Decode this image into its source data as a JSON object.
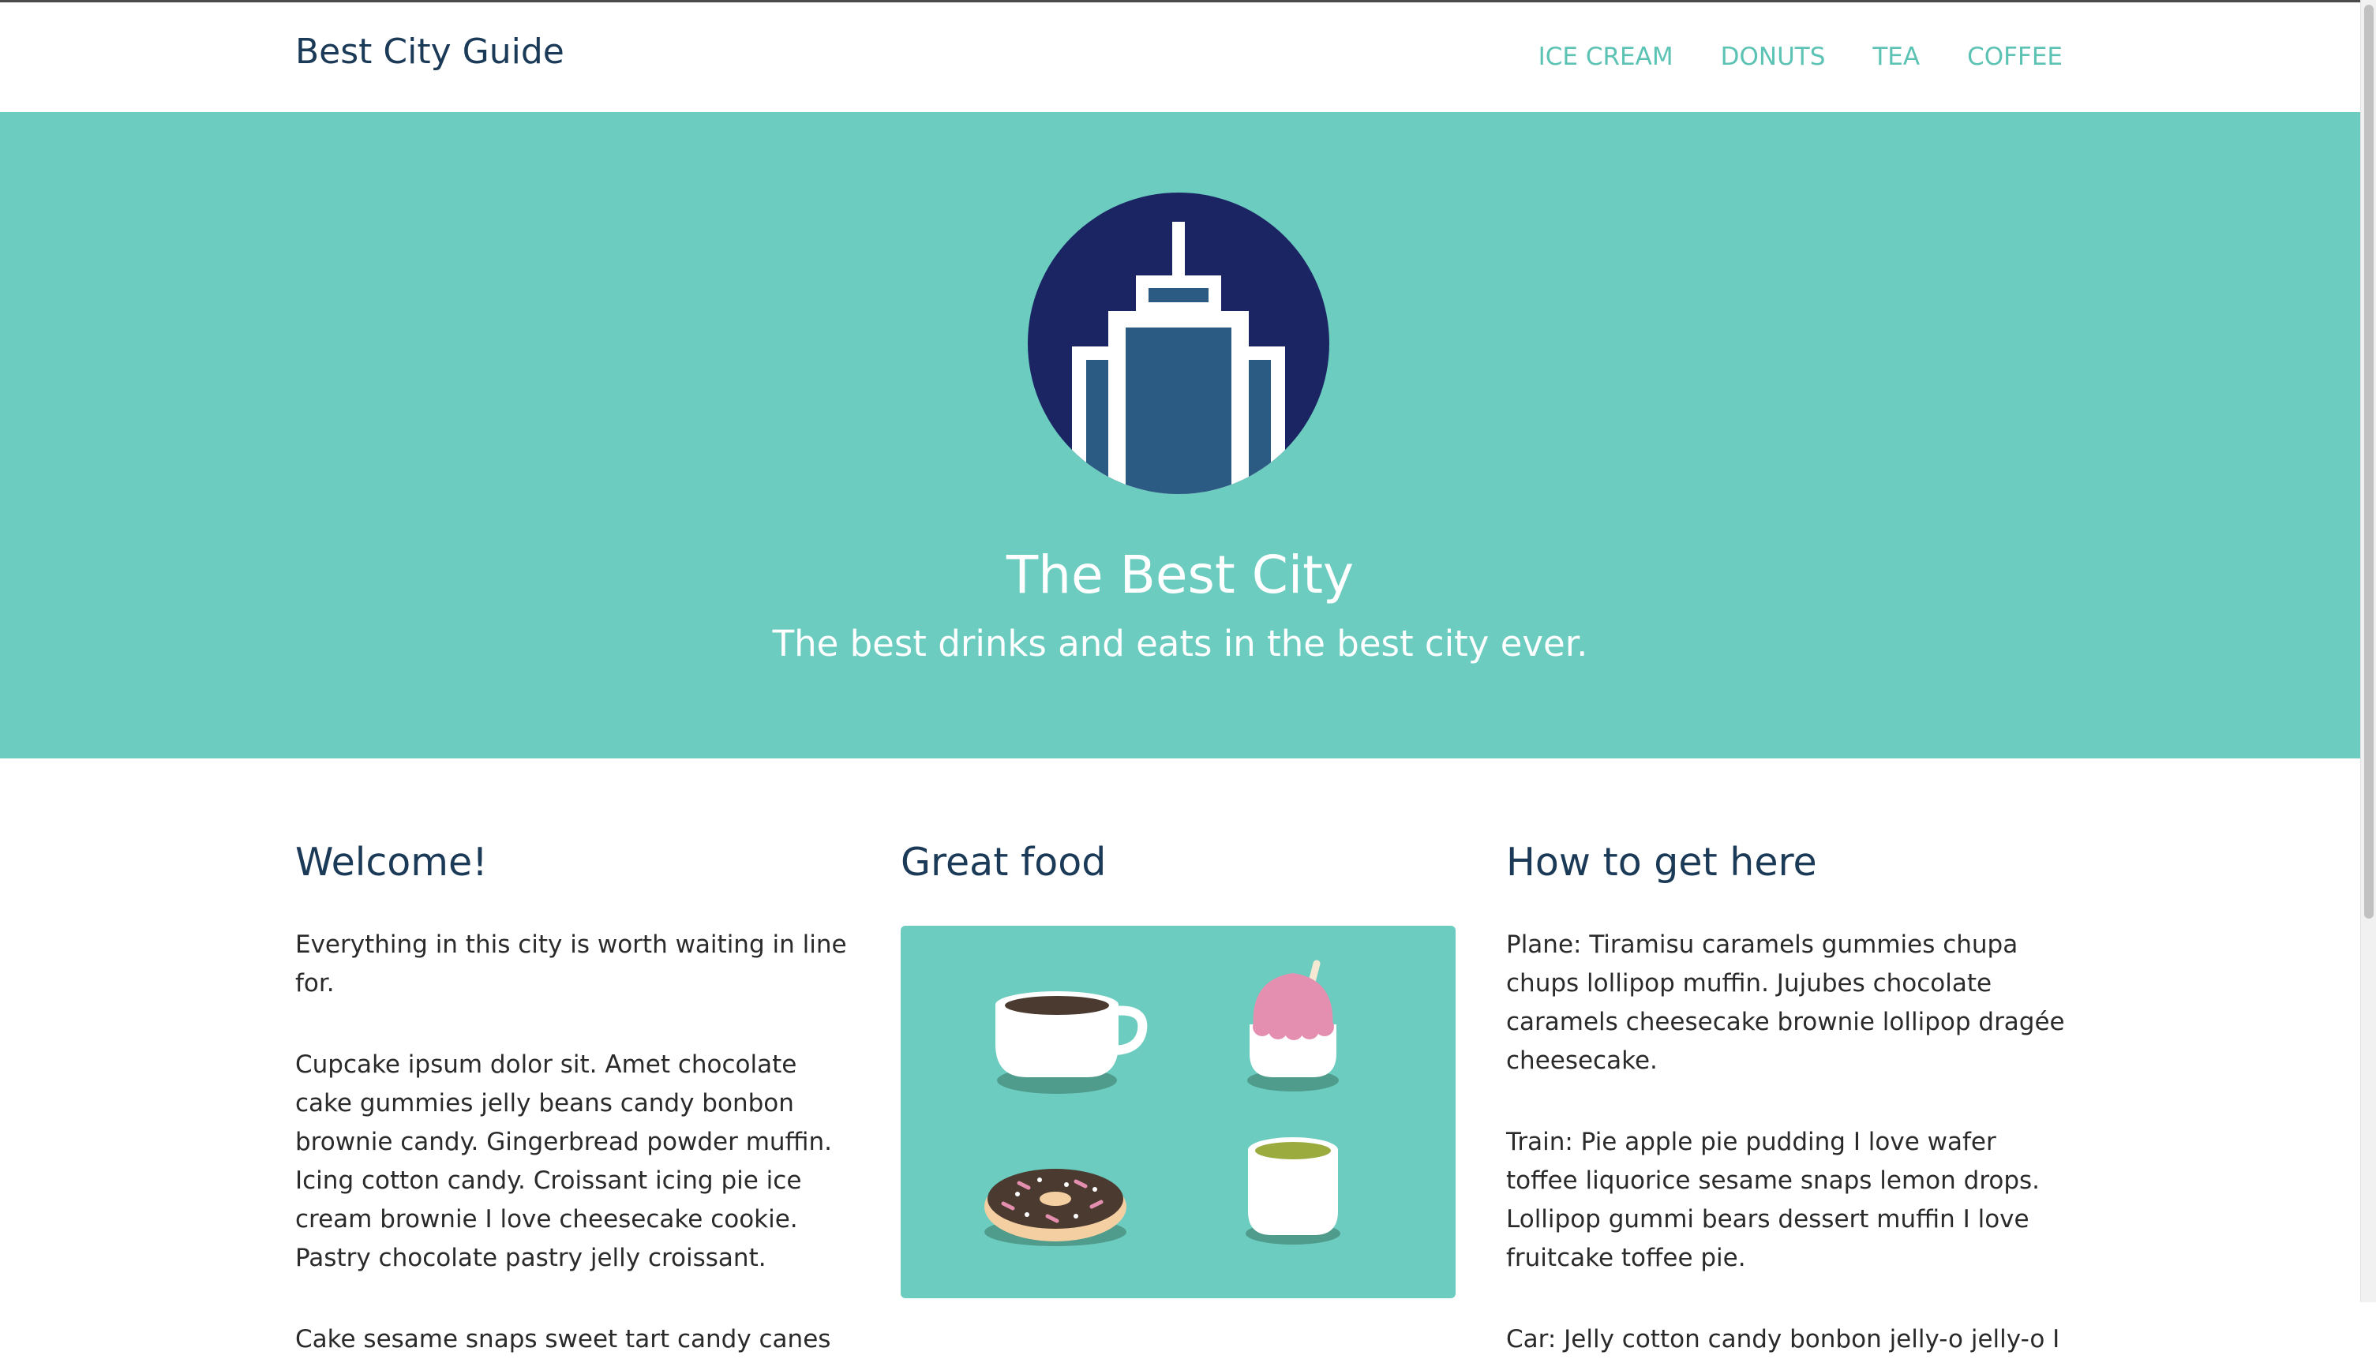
{
  "navbar": {
    "brand": "Best City Guide",
    "links": [
      "ICE CREAM",
      "DONUTS",
      "TEA",
      "COFFEE"
    ]
  },
  "hero": {
    "logo_icon": "skyscraper-icon",
    "title": "The Best City",
    "subtitle": "The best drinks and eats in the best city ever."
  },
  "columns": {
    "welcome": {
      "heading": "Welcome!",
      "paragraphs": [
        "Everything in this city is worth waiting in line for.",
        "Cupcake ipsum dolor sit. Amet chocolate cake gummies jelly beans candy bonbon brownie candy. Gingerbread powder muffin. Icing cotton candy. Croissant icing pie ice cream brownie I love cheesecake cookie. Pastry chocolate pastry jelly croissant.",
        "Cake sesame snaps sweet tart candy canes"
      ]
    },
    "food": {
      "heading": "Great food",
      "icons": [
        "coffee-cup-icon",
        "ice-cream-icon",
        "donut-icon",
        "tea-cup-icon"
      ]
    },
    "directions": {
      "heading": "How to get here",
      "paragraphs": [
        "Plane: Tiramisu caramels gummies chupa chups lollipop muffin. Jujubes chocolate caramels cheesecake brownie lollipop dragée cheesecake.",
        "Train: Pie apple pie pudding I love wafer toffee liquorice sesame snaps lemon drops. Lollipop gummi bears dessert muffin I love fruitcake toffee pie.",
        "Car: Jelly cotton candy bonbon jelly-o jelly-o I"
      ]
    }
  },
  "colors": {
    "accent": "#6cccc0",
    "nav_link": "#5cc3b4",
    "dark_navy": "#1b3a57",
    "logo_circle": "#1b2563",
    "building": "#2b5a83"
  }
}
